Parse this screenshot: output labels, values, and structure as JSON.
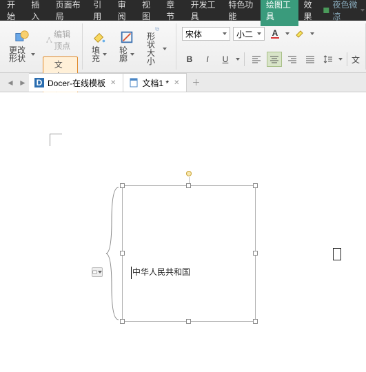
{
  "menubar": {
    "items": [
      "开始",
      "插入",
      "页面布局",
      "引用",
      "审阅",
      "视图",
      "章节",
      "开发工具",
      "特色功能",
      "绘图工具",
      "效果"
    ],
    "activeIndex": 9,
    "rightText": "夜色微凉"
  },
  "ribbon": {
    "editVertex": "编辑顶点",
    "changeShape": "更改形状",
    "textBox": "文本框",
    "fill": "填充",
    "outline": "轮廓",
    "shapeSize": "形状大小",
    "fontName": "宋体",
    "fontSize": "小二",
    "bold": "B",
    "italic": "I",
    "underline": "U",
    "textLabel": "文"
  },
  "tabs": {
    "items": [
      {
        "label": "Docer-在线模板",
        "iconBg": "#2a6db0"
      },
      {
        "label": "文档1 *",
        "iconBg": "#4a86c5"
      }
    ]
  },
  "document": {
    "textboxContent": "中华人民共和国"
  }
}
